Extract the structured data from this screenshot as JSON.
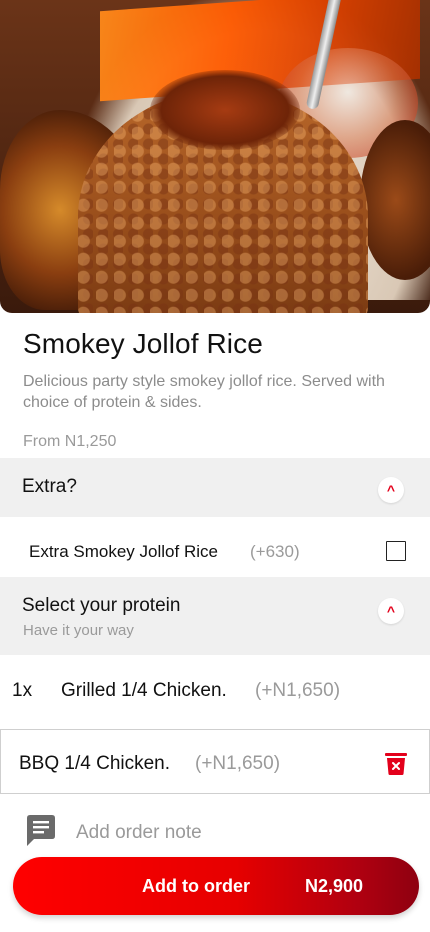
{
  "item": {
    "title": "Smokey Jollof Rice",
    "description": "Delicious party style smokey jollof rice. Served with choice of protein & sides.",
    "from_price": "From N1,250"
  },
  "extra_section": {
    "label": "Extra?",
    "toggle_icon": "^",
    "options": [
      {
        "name": "Extra Smokey Jollof Rice",
        "price": "(+630)",
        "checked": false
      }
    ]
  },
  "protein_section": {
    "label": "Select your protein",
    "subtitle": "Have it your way",
    "toggle_icon": "^",
    "selected": [
      {
        "qty": "1x",
        "name": "Grilled 1/4 Chicken.",
        "price": "(+N1,650)"
      }
    ],
    "options": [
      {
        "name": "BBQ 1/4 Chicken.",
        "price": "(+N1,650)",
        "icon": "delete-icon"
      }
    ]
  },
  "order_note": {
    "placeholder": "Add order note",
    "icon": "note-icon"
  },
  "cta": {
    "label": "Add to order",
    "price": "N2,900"
  },
  "colors": {
    "accent": "#e3001b",
    "cta_start": "#ff0000",
    "cta_end": "#8e0010",
    "section_bg": "#f0f0f0",
    "muted": "#9a9a9a"
  }
}
